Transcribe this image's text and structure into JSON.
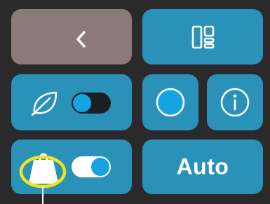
{
  "controls": {
    "back_button": {
      "icon": "chevron-left-icon"
    },
    "layout_button": {
      "icon": "layout-grid-icon"
    },
    "eco_mode": {
      "icon": "leaf-icon",
      "enabled": false
    },
    "record_button": {
      "icon": "circle-icon"
    },
    "info_button": {
      "icon": "info-icon"
    },
    "weight_mode": {
      "icon": "weight-icon",
      "enabled": true
    },
    "auto_button": {
      "label": "Auto"
    }
  },
  "annotation": {
    "color": "#f2e41c"
  },
  "colors": {
    "background": "#2a2a2a",
    "tile": "#2a92b8",
    "back_tile": "#8b7a78",
    "toggle_knob": "#15a3e2"
  }
}
